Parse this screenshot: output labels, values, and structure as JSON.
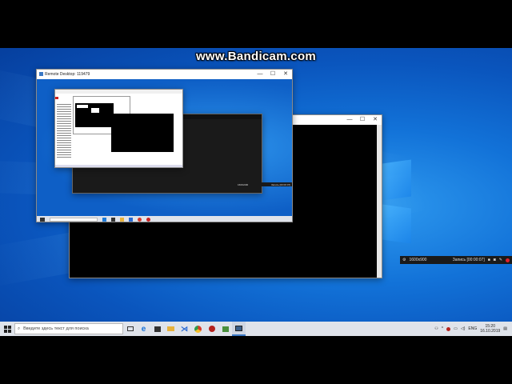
{
  "watermark": "www.Bandicam.com",
  "remote_window": {
    "title": "Remote Desktop: 119479",
    "minimize_glyph": "—",
    "maximize_glyph": "☐",
    "close_glyph": "✕"
  },
  "bandicam_bar": {
    "resolution": "1600x900",
    "recording_label": "Запись [00:00:07]"
  },
  "inner_bandicam_bar": {
    "resolution": "1600x900",
    "recording_label": "Запись [00:00:07]"
  },
  "taskbar": {
    "search_placeholder": "Введите здесь текст для поиска",
    "language": "ENG",
    "time": "15:20",
    "date": "16.10.2019"
  },
  "taskbar_icons": [
    "task-view",
    "edge",
    "store",
    "file-explorer",
    "vscode",
    "chrome",
    "app-red",
    "app-green",
    "remote-desktop"
  ],
  "colors": {
    "desktop_blue": "#0a55bd",
    "taskbar": "#dfe3ea",
    "record_red": "#e0202a"
  }
}
